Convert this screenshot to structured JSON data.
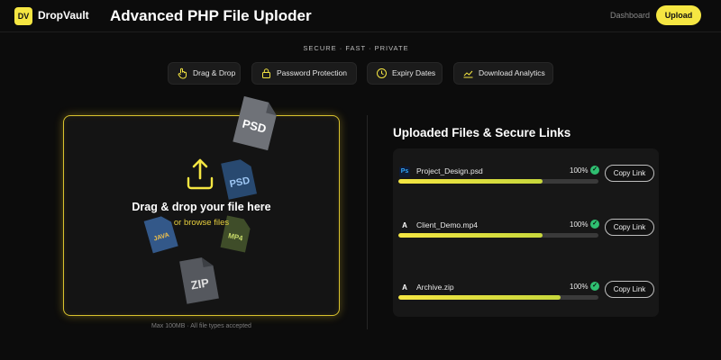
{
  "header": {
    "logo_text": "DV",
    "brand": "DropVault",
    "title": "Advanced PHP File Uploder",
    "nav_dashboard": "Dashboard",
    "upload_label": "Upload"
  },
  "tagline": "SECURE · FAST · PRIVATE",
  "features": [
    {
      "label": "Drag & Drop",
      "icon": "hand-pointer-icon"
    },
    {
      "label": "Password Protection",
      "icon": "lock-icon"
    },
    {
      "label": "Expiry Dates",
      "icon": "clock-icon"
    },
    {
      "label": "Download Analytics",
      "icon": "chart-line-icon"
    }
  ],
  "dropzone": {
    "title": "Drag & drop your file here",
    "subtitle": "or browse files",
    "hint": "Max 100MB · All file types accepted",
    "floating_icons": [
      {
        "label": "PSD",
        "icon": "psd-file-icon"
      },
      {
        "label": "PSD",
        "icon": "psd-file-icon"
      },
      {
        "label": "JAVA",
        "icon": "java-file-icon"
      },
      {
        "label": "MP4",
        "icon": "mp4-file-icon"
      },
      {
        "label": "ZIP",
        "icon": "zip-file-icon"
      }
    ]
  },
  "files_panel": {
    "title": "Uploaded Files & Secure Links",
    "files": [
      {
        "icon": "Ps",
        "name": "Project_Design.psd",
        "percent": "100%",
        "progress": 0.72,
        "action": "Copy Link"
      },
      {
        "icon": "A",
        "name": "Client_Demo.mp4",
        "percent": "100%",
        "progress": 0.72,
        "action": "Copy Link"
      },
      {
        "icon": "A",
        "name": "Archive.zip",
        "percent": "100%",
        "progress": 0.81,
        "action": "Copy Link"
      }
    ]
  },
  "colors": {
    "accent": "#f5e642",
    "background": "#0c0c0c",
    "panel": "#171717",
    "success": "#2fbf71"
  }
}
